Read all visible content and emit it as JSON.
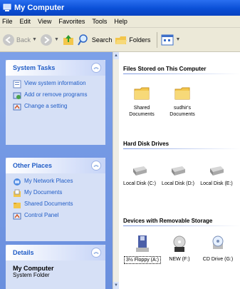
{
  "window": {
    "title": "My Computer"
  },
  "menu": [
    "File",
    "Edit",
    "View",
    "Favorites",
    "Tools",
    "Help"
  ],
  "toolbar": {
    "back": "Back",
    "search": "Search",
    "folders": "Folders"
  },
  "system_tasks": {
    "title": "System Tasks",
    "items": [
      "View system information",
      "Add or remove programs",
      "Change a setting"
    ]
  },
  "other_places": {
    "title": "Other Places",
    "items": [
      "My Network Places",
      "My Documents",
      "Shared Documents",
      "Control Panel"
    ]
  },
  "details": {
    "title": "Details",
    "name": "My Computer",
    "type": "System Folder"
  },
  "groups": {
    "stored": {
      "title": "Files Stored on This Computer",
      "items": [
        "Shared Documents",
        "sudhir's Documents"
      ]
    },
    "hdd": {
      "title": "Hard Disk Drives",
      "items": [
        "Local Disk (C:)",
        "Local Disk (D:)",
        "Local Disk (E:)"
      ]
    },
    "removable": {
      "title": "Devices with Removable Storage",
      "items": [
        "3½ Floppy (A:)",
        "NEW (F:)",
        "CD Drive (G:)"
      ]
    }
  },
  "colors": {
    "title_blue": "#0a4fd6",
    "task_text": "#215dc6",
    "pane_blue": "#6a8fde"
  }
}
